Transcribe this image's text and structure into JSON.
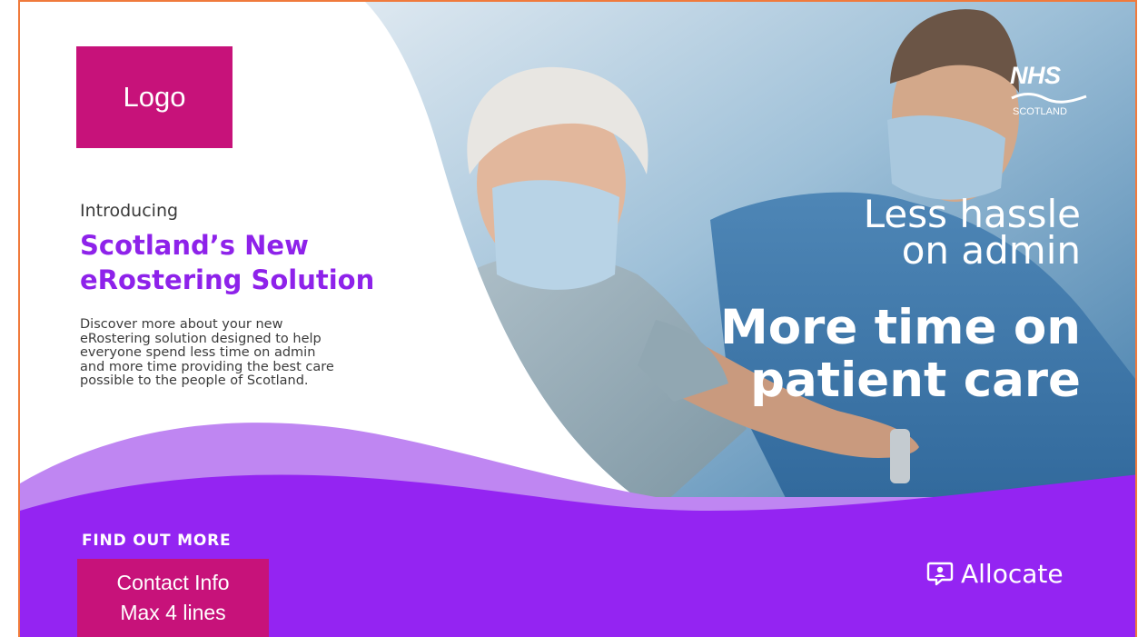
{
  "logo_placeholder": "Logo",
  "intro": "Introducing",
  "headline": [
    "Scotland’s New",
    "eRostering Solution"
  ],
  "description": [
    "Discover more about your new",
    "eRostering solution designed to help",
    "everyone spend less time on admin",
    "and more time providing the best care",
    "possible to the people of Scotland."
  ],
  "tagline_small": [
    "Less hassle",
    "on admin"
  ],
  "tagline_big": [
    "More time on",
    "patient care"
  ],
  "nhs": {
    "word": "NHS",
    "sub": "SCOTLAND"
  },
  "find_more": "FIND OUT MORE",
  "contact_box": [
    "Contact Info",
    "Max 4 lines"
  ],
  "brand": {
    "name": "Allocate",
    "icon": "allocate-chat-icon"
  },
  "colors": {
    "purple": "#8e22ea",
    "magenta": "#c7127a",
    "border": "#f07a3c",
    "photo_tint": "#6a9cc0"
  }
}
